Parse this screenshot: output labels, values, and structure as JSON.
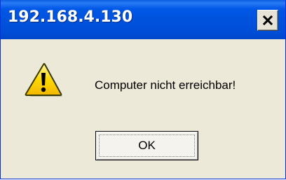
{
  "window": {
    "title": "192.168.4.130",
    "close_icon": "close-icon",
    "titlebar_color": "#0052dd"
  },
  "dialog": {
    "icon": "warning-icon",
    "message": "Computer nicht erreichbar!",
    "ok_label": "OK"
  }
}
